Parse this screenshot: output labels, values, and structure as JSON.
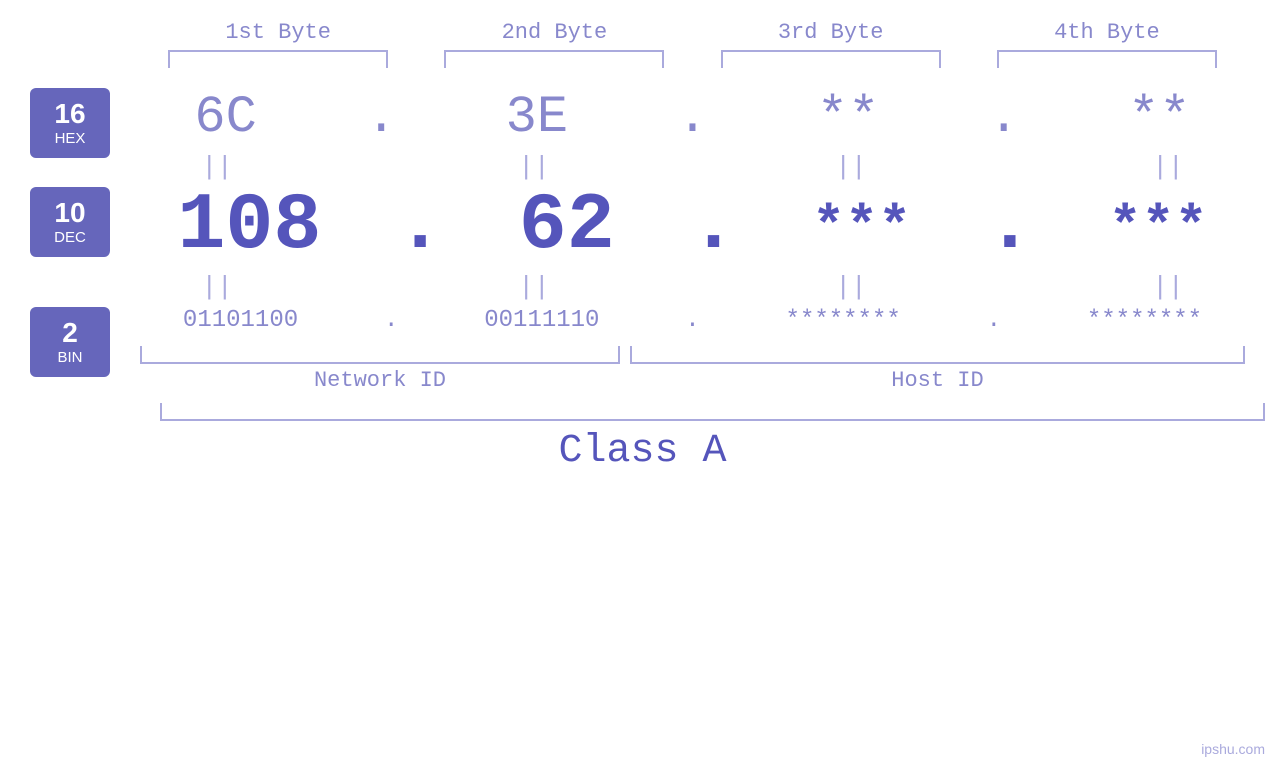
{
  "header": {
    "byte1_label": "1st Byte",
    "byte2_label": "2nd Byte",
    "byte3_label": "3rd Byte",
    "byte4_label": "4th Byte"
  },
  "badges": {
    "hex": {
      "num": "16",
      "name": "HEX"
    },
    "dec": {
      "num": "10",
      "name": "DEC"
    },
    "bin": {
      "num": "2",
      "name": "BIN"
    }
  },
  "data": {
    "hex": {
      "b1": "6C",
      "b2": "3E",
      "b3": "**",
      "b4": "**",
      "dot": "."
    },
    "dec": {
      "b1": "108",
      "b2": "62",
      "b3": "***",
      "b4": "***",
      "dot": "."
    },
    "bin": {
      "b1": "01101100",
      "b2": "00111110",
      "b3": "********",
      "b4": "********",
      "dot": "."
    },
    "equals": "||"
  },
  "labels": {
    "network_id": "Network ID",
    "host_id": "Host ID",
    "class": "Class A"
  },
  "watermark": "ipshu.com",
  "colors": {
    "accent": "#6666bb",
    "light": "#8888cc",
    "dark": "#5555bb",
    "muted": "#aaaadd"
  }
}
